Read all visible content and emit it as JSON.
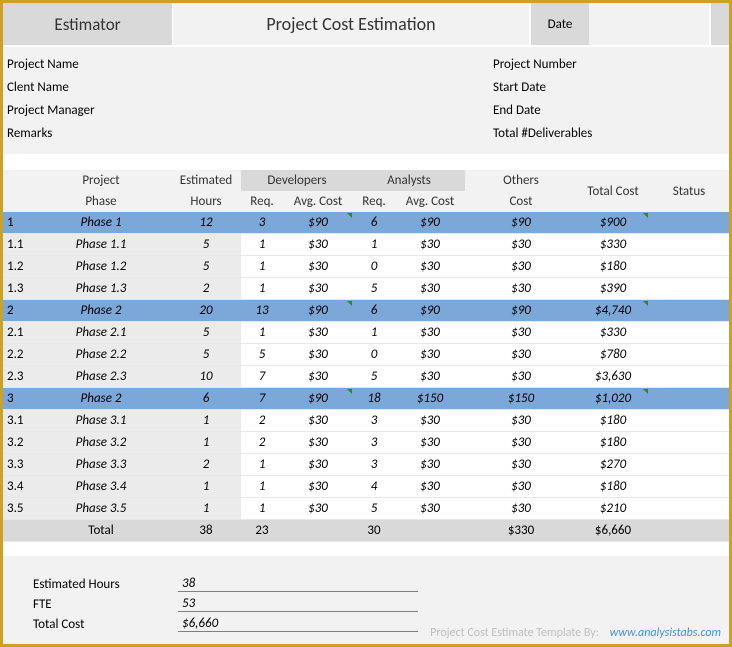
{
  "header": {
    "logo": "Estimator",
    "title": "Project Cost Estimation",
    "date_label": "Date"
  },
  "info_left": [
    "Project Name",
    "Clent Name",
    "Project Manager",
    "Remarks"
  ],
  "info_right": [
    "Project Number",
    "Start Date",
    "End Date",
    "Total #Deliverables"
  ],
  "columns": {
    "project": "Project",
    "phase": "Phase",
    "estimated": "Estimated",
    "hours": "Hours",
    "developers": "Developers",
    "analysts": "Analysts",
    "req": "Req.",
    "avgcost": "Avg. Cost",
    "others": "Others",
    "cost": "Cost",
    "totalcost": "Total Cost",
    "status": "Status"
  },
  "rows": [
    {
      "lvl": 0,
      "num": "1",
      "phase": "Phase 1",
      "hours": "12",
      "dreq": "3",
      "davg": "$90",
      "areq": "6",
      "aavg": "$90",
      "oth": "$90",
      "tot": "$900"
    },
    {
      "lvl": 1,
      "num": "1.1",
      "phase": "Phase 1.1",
      "hours": "5",
      "dreq": "1",
      "davg": "$30",
      "areq": "1",
      "aavg": "$30",
      "oth": "$30",
      "tot": "$330"
    },
    {
      "lvl": 1,
      "num": "1.2",
      "phase": "Phase 1.2",
      "hours": "5",
      "dreq": "1",
      "davg": "$30",
      "areq": "0",
      "aavg": "$30",
      "oth": "$30",
      "tot": "$180"
    },
    {
      "lvl": 1,
      "num": "1.3",
      "phase": "Phase 1.3",
      "hours": "2",
      "dreq": "1",
      "davg": "$30",
      "areq": "5",
      "aavg": "$30",
      "oth": "$30",
      "tot": "$390"
    },
    {
      "lvl": 0,
      "num": "2",
      "phase": "Phase 2",
      "hours": "20",
      "dreq": "13",
      "davg": "$90",
      "areq": "6",
      "aavg": "$90",
      "oth": "$90",
      "tot": "$4,740"
    },
    {
      "lvl": 1,
      "num": "2.1",
      "phase": "Phase 2.1",
      "hours": "5",
      "dreq": "1",
      "davg": "$30",
      "areq": "1",
      "aavg": "$30",
      "oth": "$30",
      "tot": "$330"
    },
    {
      "lvl": 1,
      "num": "2.2",
      "phase": "Phase 2.2",
      "hours": "5",
      "dreq": "5",
      "davg": "$30",
      "areq": "0",
      "aavg": "$30",
      "oth": "$30",
      "tot": "$780"
    },
    {
      "lvl": 1,
      "num": "2.3",
      "phase": "Phase 2.3",
      "hours": "10",
      "dreq": "7",
      "davg": "$30",
      "areq": "5",
      "aavg": "$30",
      "oth": "$30",
      "tot": "$3,630"
    },
    {
      "lvl": 0,
      "num": "3",
      "phase": "Phase 2",
      "hours": "6",
      "dreq": "7",
      "davg": "$90",
      "areq": "18",
      "aavg": "$150",
      "oth": "$150",
      "tot": "$1,020"
    },
    {
      "lvl": 1,
      "num": "3.1",
      "phase": "Phase 3.1",
      "hours": "1",
      "dreq": "2",
      "davg": "$30",
      "areq": "3",
      "aavg": "$30",
      "oth": "$30",
      "tot": "$180"
    },
    {
      "lvl": 1,
      "num": "3.2",
      "phase": "Phase 3.2",
      "hours": "1",
      "dreq": "2",
      "davg": "$30",
      "areq": "3",
      "aavg": "$30",
      "oth": "$30",
      "tot": "$180"
    },
    {
      "lvl": 1,
      "num": "3.3",
      "phase": "Phase 3.3",
      "hours": "2",
      "dreq": "1",
      "davg": "$30",
      "areq": "3",
      "aavg": "$30",
      "oth": "$30",
      "tot": "$270"
    },
    {
      "lvl": 1,
      "num": "3.4",
      "phase": "Phase 3.4",
      "hours": "1",
      "dreq": "1",
      "davg": "$30",
      "areq": "4",
      "aavg": "$30",
      "oth": "$30",
      "tot": "$180"
    },
    {
      "lvl": 1,
      "num": "3.5",
      "phase": "Phase 3.5",
      "hours": "1",
      "dreq": "1",
      "davg": "$30",
      "areq": "5",
      "aavg": "$30",
      "oth": "$30",
      "tot": "$210"
    }
  ],
  "total": {
    "label": "Total",
    "hours": "38",
    "dreq": "23",
    "areq": "30",
    "oth": "$330",
    "tot": "$6,660"
  },
  "summary": {
    "est_hours_label": "Estimated Hours",
    "est_hours_val": "38",
    "fte_label": "FTE",
    "fte_val": "53",
    "totalcost_label": "Total Cost",
    "totalcost_val": "$6,660"
  },
  "footer": {
    "text": "Project Cost Estimate Template By:",
    "link": "www.analysistabs.com"
  }
}
